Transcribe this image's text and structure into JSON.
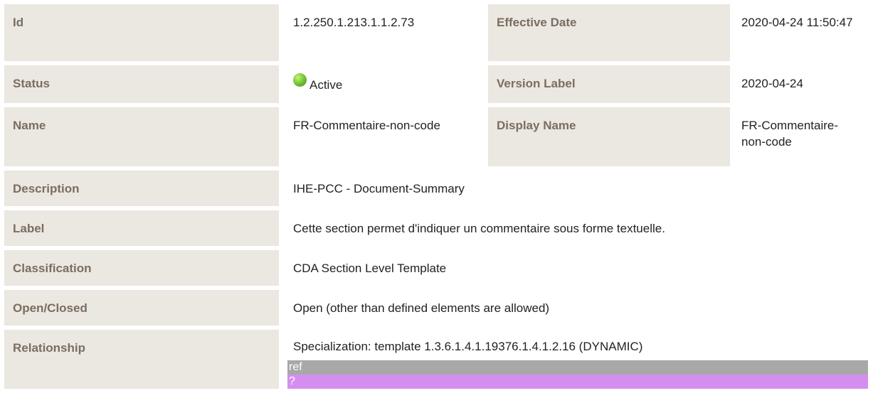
{
  "rows": {
    "id": {
      "label": "Id",
      "value": "1.2.250.1.213.1.1.2.73"
    },
    "effective_date": {
      "label": "Effective Date",
      "value": "2020-04-24 11:50:47"
    },
    "status": {
      "label": "Status",
      "value": "Active",
      "icon": "status-active-icon",
      "icon_color": "#5fb52e"
    },
    "version_label": {
      "label": "Version Label",
      "value": "2020-04-24"
    },
    "name": {
      "label": "Name",
      "value": "FR-Commentaire-non-code"
    },
    "display_name": {
      "label": "Display Name",
      "value": "FR-Commentaire-non-code"
    },
    "description": {
      "label": "Description",
      "value": "IHE-PCC - Document-Summary"
    },
    "label": {
      "label": "Label",
      "value": "Cette section permet d'indiquer un commentaire sous forme textuelle."
    },
    "classification": {
      "label": "Classification",
      "value": "CDA Section Level Template"
    },
    "open_closed": {
      "label": "Open/Closed",
      "value": "Open (other than defined elements are allowed)"
    },
    "relationship": {
      "label": "Relationship",
      "value": "Specialization: template 1.3.6.1.4.1.19376.1.4.1.2.16 (DYNAMIC)",
      "ref_label": "ref",
      "ref_value": "?"
    }
  },
  "colors": {
    "label_bg": "#ebe7e1",
    "label_text": "#7a6e61",
    "ref_bar": "#a8a8a8",
    "unknown_bar": "#d48ef0"
  }
}
